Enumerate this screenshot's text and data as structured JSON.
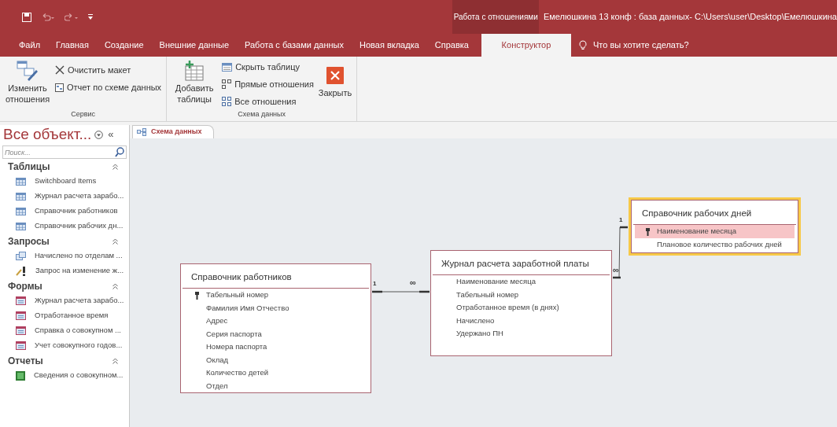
{
  "title_bar": {
    "context_label": "Работа с отношениями",
    "title": "Емелюшкина 13 конф : база данных- C:\\Users\\user\\Desktop\\Емелюшкина"
  },
  "menu_tabs": [
    {
      "label": "Файл",
      "selected": false
    },
    {
      "label": "Главная",
      "selected": false
    },
    {
      "label": "Создание",
      "selected": false
    },
    {
      "label": "Внешние данные",
      "selected": false
    },
    {
      "label": "Работа с базами данных",
      "selected": false
    },
    {
      "label": "Новая вкладка",
      "selected": false
    },
    {
      "label": "Справка",
      "selected": false
    },
    {
      "label": "Конструктор",
      "selected": true
    }
  ],
  "tell_me": "Что вы хотите сделать?",
  "ribbon_groups": [
    {
      "label": "Сервис",
      "buttons": [
        {
          "kind": "edit",
          "label": "Изменить отношения"
        },
        {
          "kind": "clear",
          "label": "Очистить макет"
        },
        {
          "kind": "report",
          "label": "Отчет по схеме данных"
        }
      ]
    },
    {
      "label": "Схема данных",
      "buttons": [
        {
          "kind": "add",
          "label": "Добавить таблицы"
        },
        {
          "kind": "hide",
          "label": "Скрыть таблицу"
        },
        {
          "kind": "direct",
          "label": "Прямые отношения"
        },
        {
          "kind": "all",
          "label": "Все отношения"
        },
        {
          "kind": "close",
          "label": "Закрыть"
        }
      ]
    }
  ],
  "nav_pane": {
    "title": "Все объект...",
    "collapse_glyph": "«",
    "search_placeholder": "Поиск...",
    "groups": [
      {
        "label": "Таблицы",
        "items": [
          {
            "kind": "table",
            "label": "Switchboard Items"
          },
          {
            "kind": "table",
            "label": "Журнал расчета зарабо..."
          },
          {
            "kind": "table",
            "label": "Справочник работников"
          },
          {
            "kind": "table",
            "label": "Справочник рабочих дн..."
          }
        ]
      },
      {
        "label": "Запросы",
        "items": [
          {
            "kind": "query",
            "label": "Начислено по отделам ..."
          },
          {
            "kind": "update_query",
            "label": "Запрос на изменение ж..."
          }
        ]
      },
      {
        "label": "Формы",
        "items": [
          {
            "kind": "form",
            "label": "Журнал расчета зарабо..."
          },
          {
            "kind": "form",
            "label": "Отработанное время"
          },
          {
            "kind": "form",
            "label": "Справка о совокупном ..."
          },
          {
            "kind": "form",
            "label": "Учет совокупного годов..."
          }
        ]
      },
      {
        "label": "Отчеты",
        "items": [
          {
            "kind": "report",
            "label": "Сведения о совокупном..."
          }
        ]
      }
    ]
  },
  "doc_tab": {
    "label": "Схема данных",
    "selected": true
  },
  "tables": [
    {
      "name": "Справочник работников",
      "selected": false,
      "fields": [
        {
          "name": "Табельный номер",
          "key": true,
          "selected": false
        },
        {
          "name": "Фамилия Имя Отчество",
          "key": false,
          "selected": false
        },
        {
          "name": "Адрес",
          "key": false,
          "selected": false
        },
        {
          "name": "Серия паспорта",
          "key": false,
          "selected": false
        },
        {
          "name": "Номера паспорта",
          "key": false,
          "selected": false
        },
        {
          "name": "Оклад",
          "key": false,
          "selected": false
        },
        {
          "name": "Количество детей",
          "key": false,
          "selected": false
        },
        {
          "name": "Отдел",
          "key": false,
          "selected": false
        }
      ]
    },
    {
      "name": "Журнал расчета заработной платы",
      "selected": false,
      "fields": [
        {
          "name": "Наименование месяца",
          "key": false,
          "selected": false
        },
        {
          "name": "Табельный номер",
          "key": false,
          "selected": false
        },
        {
          "name": "Отработанное время (в днях)",
          "key": false,
          "selected": false
        },
        {
          "name": "Начислено",
          "key": false,
          "selected": false
        },
        {
          "name": "Удержано ПН",
          "key": false,
          "selected": false
        }
      ]
    },
    {
      "name": "Справочник рабочих дней",
      "selected": true,
      "fields": [
        {
          "name": "Наименование месяца",
          "key": true,
          "selected": true
        },
        {
          "name": "Плановое количество рабочих дней",
          "key": false,
          "selected": false
        }
      ]
    }
  ],
  "relationships": [
    {
      "one_label": "1",
      "many_label": "∞"
    },
    {
      "one_label": "1",
      "many_label": "∞"
    }
  ]
}
